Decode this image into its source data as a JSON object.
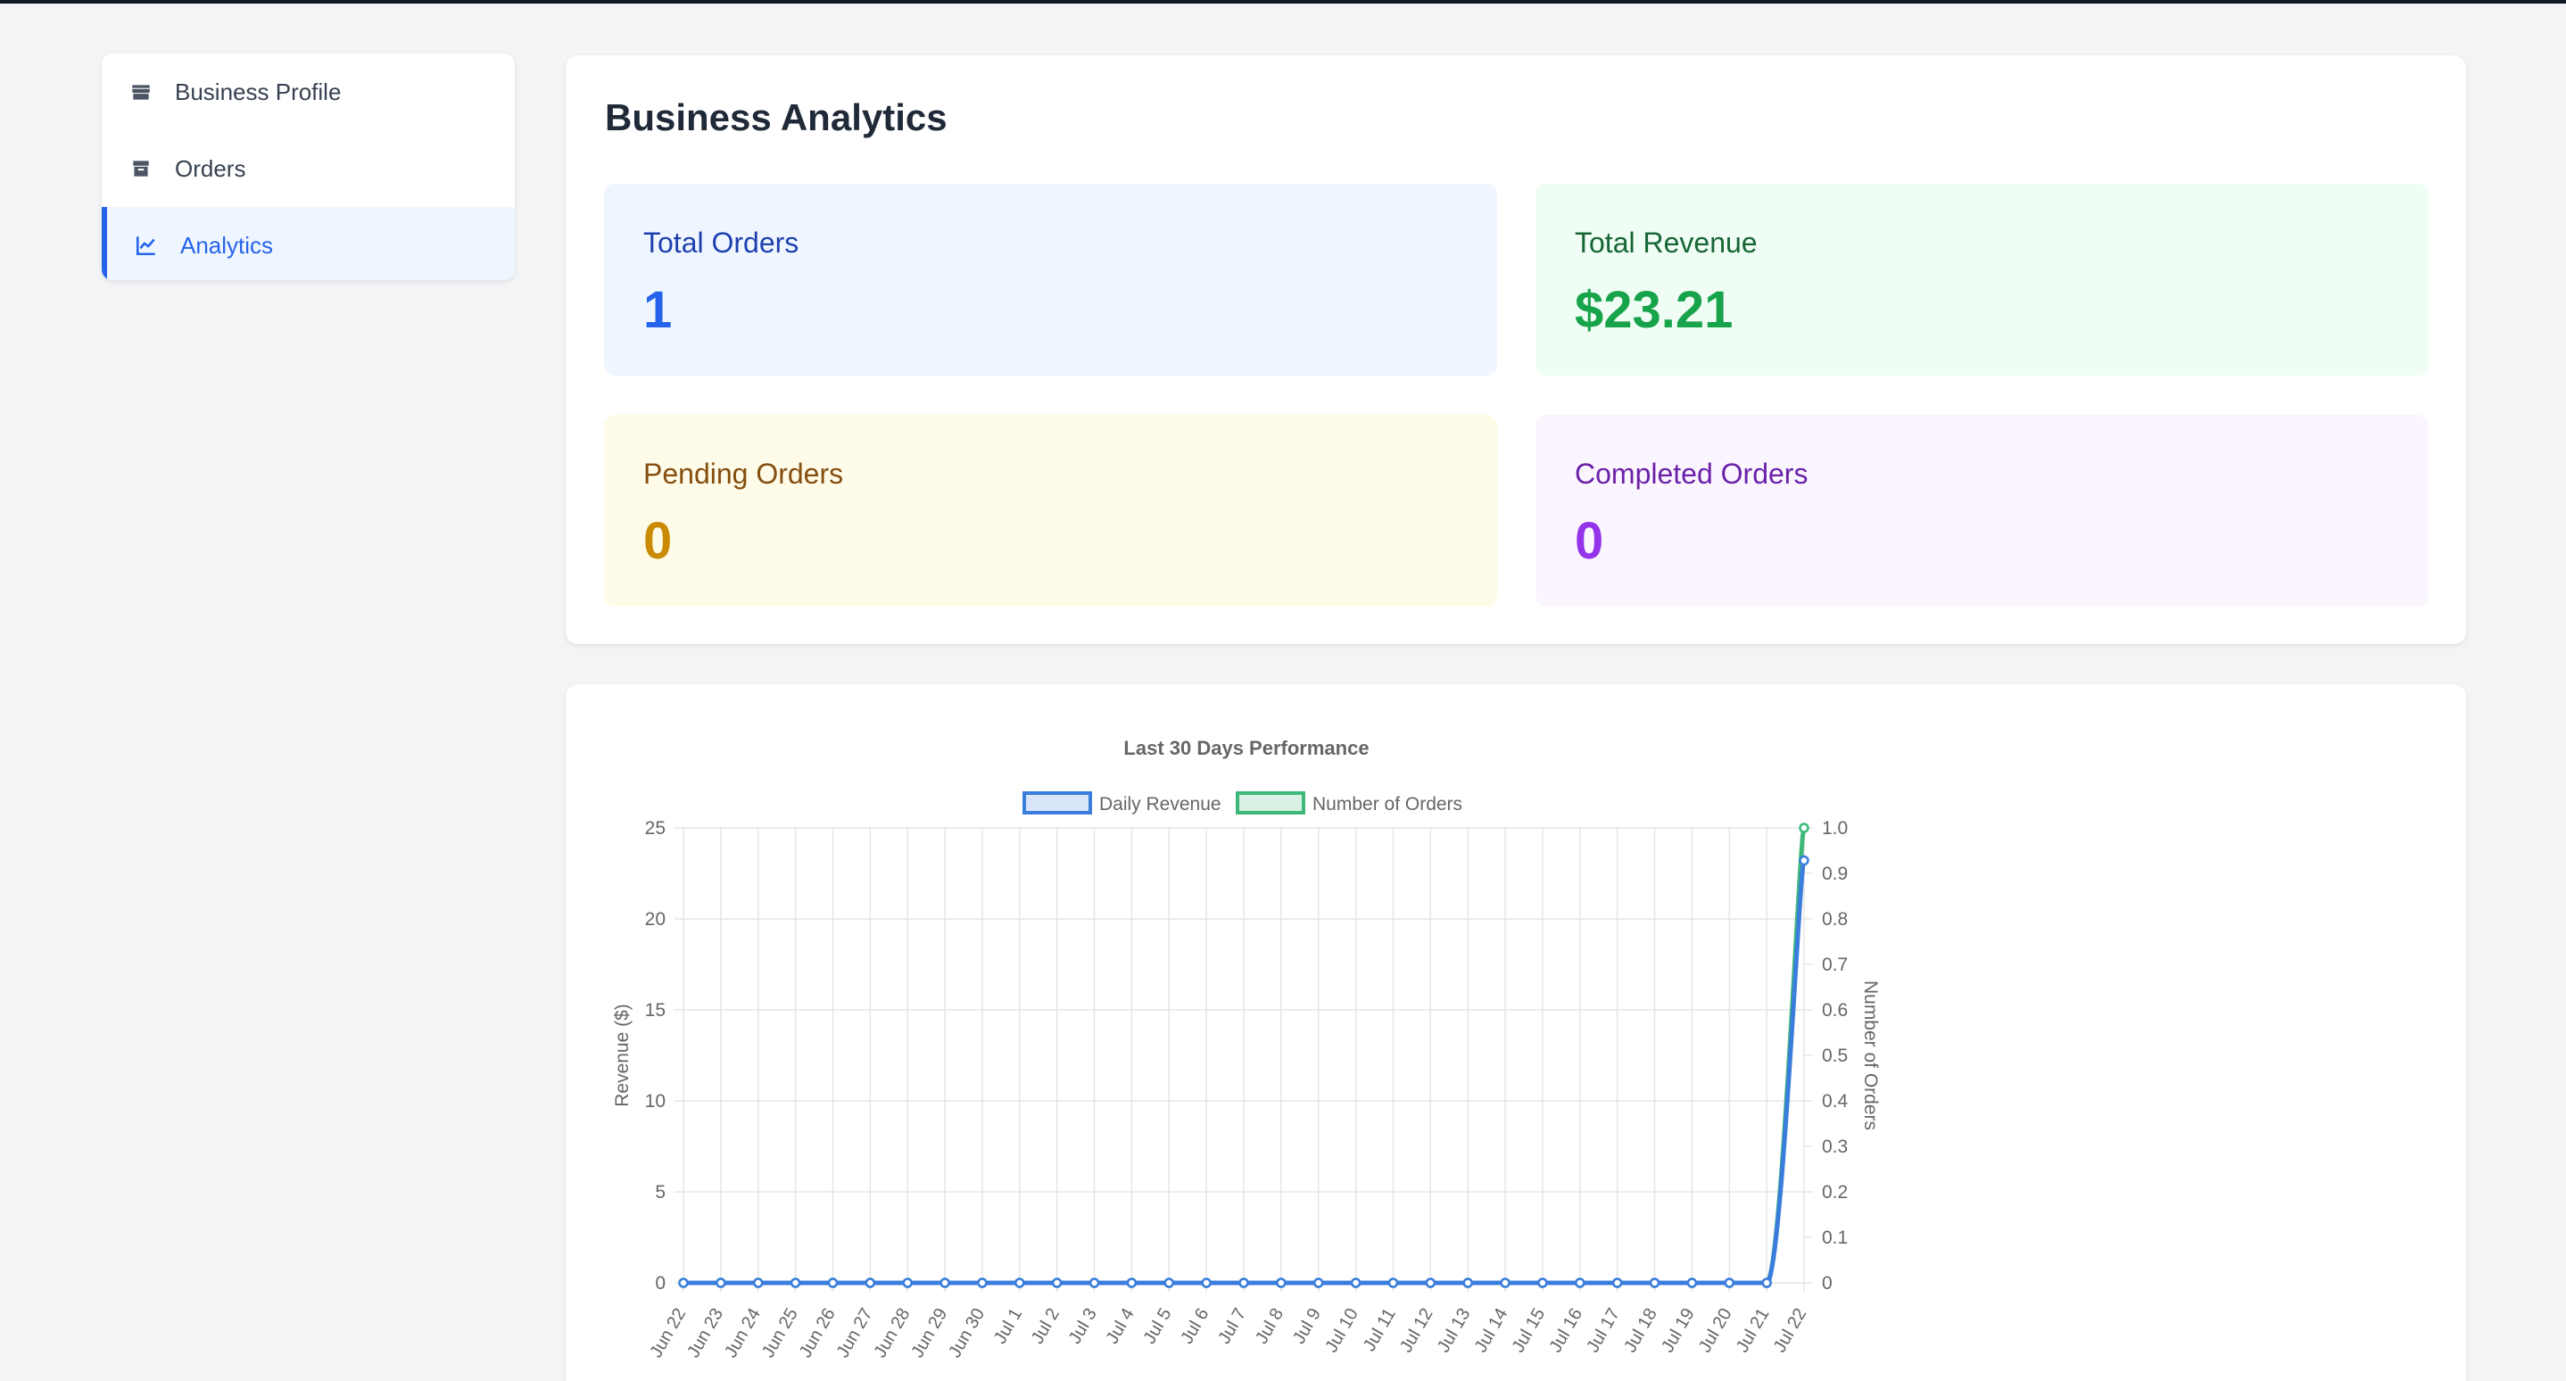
{
  "sidebar": {
    "items": [
      {
        "label": "Business Profile",
        "icon": "store-icon",
        "active": false
      },
      {
        "label": "Orders",
        "icon": "box-icon",
        "active": false
      },
      {
        "label": "Analytics",
        "icon": "chart-line-icon",
        "active": true
      }
    ]
  },
  "analytics": {
    "title": "Business Analytics",
    "stats": {
      "total_orders": {
        "label": "Total Orders",
        "value": "1"
      },
      "total_revenue": {
        "label": "Total Revenue",
        "value": "$23.21"
      },
      "pending_orders": {
        "label": "Pending Orders",
        "value": "0"
      },
      "completed_orders": {
        "label": "Completed Orders",
        "value": "0"
      }
    }
  },
  "colors": {
    "accent": "#2563eb",
    "revenue_line": "#3b7ddd",
    "orders_line": "#3cb878"
  },
  "chart_data": {
    "type": "line",
    "title": "Last 30 Days Performance",
    "legend_position": "top",
    "grid": true,
    "categories": [
      "Jun 22",
      "Jun 23",
      "Jun 24",
      "Jun 25",
      "Jun 26",
      "Jun 27",
      "Jun 28",
      "Jun 29",
      "Jun 30",
      "Jul 1",
      "Jul 2",
      "Jul 3",
      "Jul 4",
      "Jul 5",
      "Jul 6",
      "Jul 7",
      "Jul 8",
      "Jul 9",
      "Jul 10",
      "Jul 11",
      "Jul 12",
      "Jul 13",
      "Jul 14",
      "Jul 15",
      "Jul 16",
      "Jul 17",
      "Jul 18",
      "Jul 19",
      "Jul 20",
      "Jul 21",
      "Jul 22"
    ],
    "y_left": {
      "label": "Revenue ($)",
      "min": 0,
      "max": 25,
      "ticks": [
        "0",
        "5",
        "10",
        "15",
        "20",
        "25"
      ]
    },
    "y_right": {
      "label": "Number of Orders",
      "min": 0,
      "max": 1,
      "ticks": [
        "0",
        "0.1",
        "0.2",
        "0.3",
        "0.4",
        "0.5",
        "0.6",
        "0.7",
        "0.8",
        "0.9",
        "1.0"
      ]
    },
    "series": [
      {
        "name": "Daily Revenue",
        "axis": "left",
        "color": "#3b7ddd",
        "values": [
          0,
          0,
          0,
          0,
          0,
          0,
          0,
          0,
          0,
          0,
          0,
          0,
          0,
          0,
          0,
          0,
          0,
          0,
          0,
          0,
          0,
          0,
          0,
          0,
          0,
          0,
          0,
          0,
          0,
          0,
          23.21
        ]
      },
      {
        "name": "Number of Orders",
        "axis": "right",
        "color": "#3cb878",
        "values": [
          0,
          0,
          0,
          0,
          0,
          0,
          0,
          0,
          0,
          0,
          0,
          0,
          0,
          0,
          0,
          0,
          0,
          0,
          0,
          0,
          0,
          0,
          0,
          0,
          0,
          0,
          0,
          0,
          0,
          0,
          1
        ]
      }
    ]
  }
}
